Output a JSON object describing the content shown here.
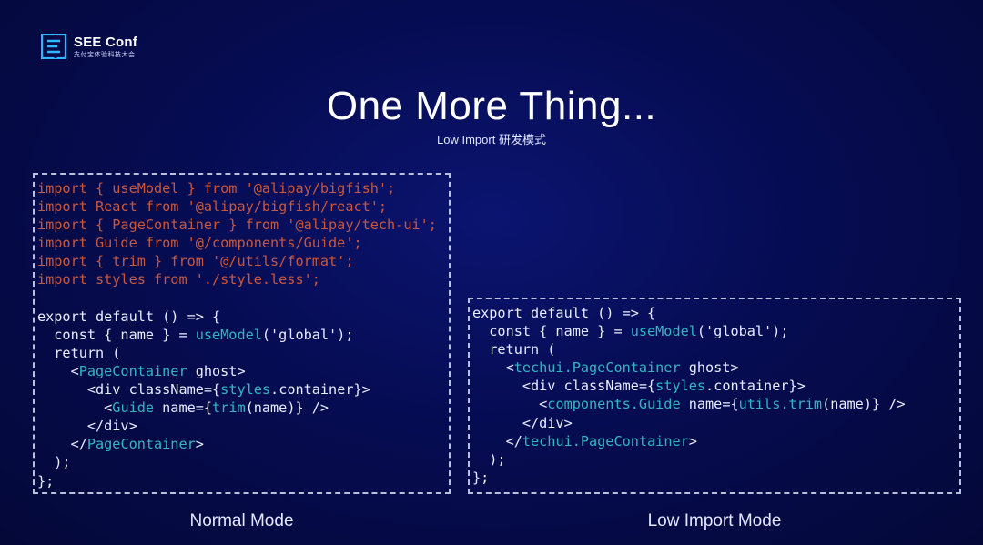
{
  "brand": {
    "title": "SEE Conf",
    "subtitle": "支付宝体验科技大会",
    "logo_icon": "see-conf-logo-icon",
    "accent": "#2fb8ff"
  },
  "slide": {
    "title": "One More Thing...",
    "subtitle": "Low Import 研发模式"
  },
  "colors": {
    "background": "#060c52",
    "import_text": "#c9573b",
    "highlight_text": "#33b6c2",
    "plain_text": "#e8ecff",
    "dashed_border": "#b9c0dc"
  },
  "normal_mode": {
    "caption": "Normal Mode",
    "lines": {
      "l1": "import { useModel } from '@alipay/bigfish';",
      "l2": "import React from '@alipay/bigfish/react';",
      "l3": "import { PageContainer } from '@alipay/tech-ui';",
      "l4": "import Guide from '@/components/Guide';",
      "l5": "import { trim } from '@/utils/format';",
      "l6": "import styles from './style.less';",
      "l8": "export default () => {",
      "l9a": "  const { name } = ",
      "l9b": "useModel",
      "l9c": "('global');",
      "l10": "  return (",
      "l11a": "    <",
      "l11b": "PageContainer",
      "l11c": " ghost>",
      "l12a": "      <div className={",
      "l12b": "styles",
      "l12c": ".container}>",
      "l13a": "        <",
      "l13b": "Guide",
      "l13c": " name={",
      "l13d": "trim",
      "l13e": "(name)} />",
      "l14": "      </div>",
      "l15a": "    </",
      "l15b": "PageContainer",
      "l15c": ">",
      "l16": "  );",
      "l17": "};"
    }
  },
  "low_import_mode": {
    "caption": "Low Import Mode",
    "lines": {
      "l1": "export default () => {",
      "l2a": "  const { name } = ",
      "l2b": "useModel",
      "l2c": "('global');",
      "l3": "  return (",
      "l4a": "    <",
      "l4b": "techui.PageContainer",
      "l4c": " ghost>",
      "l5a": "      <div className={",
      "l5b": "styles",
      "l5c": ".container}>",
      "l6a": "        <",
      "l6b": "components.Guide",
      "l6c": " name={",
      "l6d": "utils.trim",
      "l6e": "(name)} />",
      "l7": "      </div>",
      "l8a": "    </",
      "l8b": "techui.PageContainer",
      "l8c": ">",
      "l9": "  );",
      "l10": "};"
    }
  }
}
